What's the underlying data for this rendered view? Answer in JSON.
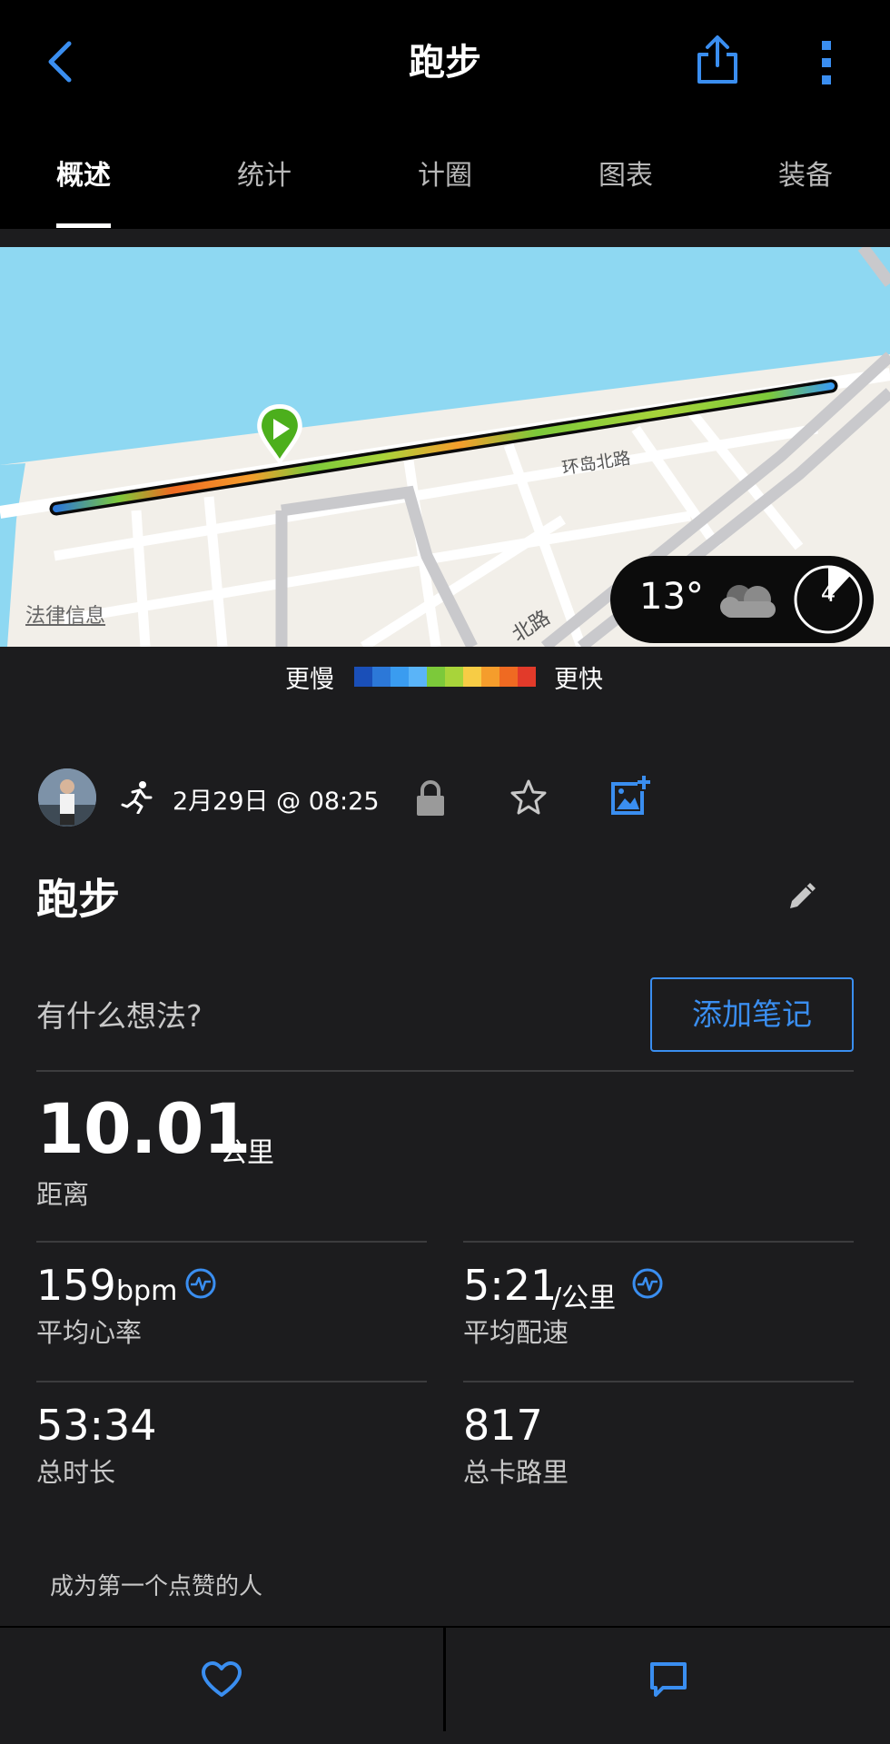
{
  "header": {
    "title": "跑步",
    "back_icon": "chevron-left-icon",
    "share_icon": "share-icon",
    "more_icon": "more-vertical-icon",
    "accent_color": "#3a8ef0"
  },
  "tabs": [
    {
      "label": "概述",
      "active": true
    },
    {
      "label": "统计",
      "active": false
    },
    {
      "label": "计圈",
      "active": false
    },
    {
      "label": "图表",
      "active": false
    },
    {
      "label": "装备",
      "active": false
    }
  ],
  "map": {
    "legal_link": "法律信息",
    "road_labels": [
      "环岛北路",
      "北路"
    ],
    "weather": {
      "temperature": "13°",
      "condition_icon": "cloud-icon",
      "indicator_value": "4"
    }
  },
  "pace_legend": {
    "slow_label": "更慢",
    "fast_label": "更快",
    "colors": [
      "#1a4fb8",
      "#2c78d8",
      "#3a9cf0",
      "#5ab4f8",
      "#7cc93a",
      "#a8d43a",
      "#f7cc45",
      "#f59d2c",
      "#ef6a22",
      "#e23a2a"
    ]
  },
  "activity": {
    "date": "2月29日 @ 08:25",
    "type_icon": "running-icon",
    "privacy_icon": "lock-icon",
    "favorite_icon": "star-icon",
    "add_photo_icon": "add-photo-icon",
    "title": "跑步",
    "edit_icon": "pencil-icon"
  },
  "notes": {
    "prompt": "有什么想法?",
    "button_label": "添加笔记"
  },
  "stats": {
    "distance": {
      "value": "10.01",
      "unit": "公里",
      "label": "距离"
    },
    "avg_hr": {
      "value": "159",
      "unit": "bpm",
      "label": "平均心率",
      "icon": "heart-rate-icon"
    },
    "avg_pace": {
      "value": "5:21",
      "unit": "/公里",
      "label": "平均配速",
      "icon": "heart-rate-icon"
    },
    "duration": {
      "value": "53:34",
      "label": "总时长"
    },
    "calories": {
      "value": "817",
      "label": "总卡路里"
    }
  },
  "social": {
    "likes_text": "成为第一个点赞的人",
    "like_icon": "heart-icon",
    "comment_icon": "comment-icon"
  }
}
